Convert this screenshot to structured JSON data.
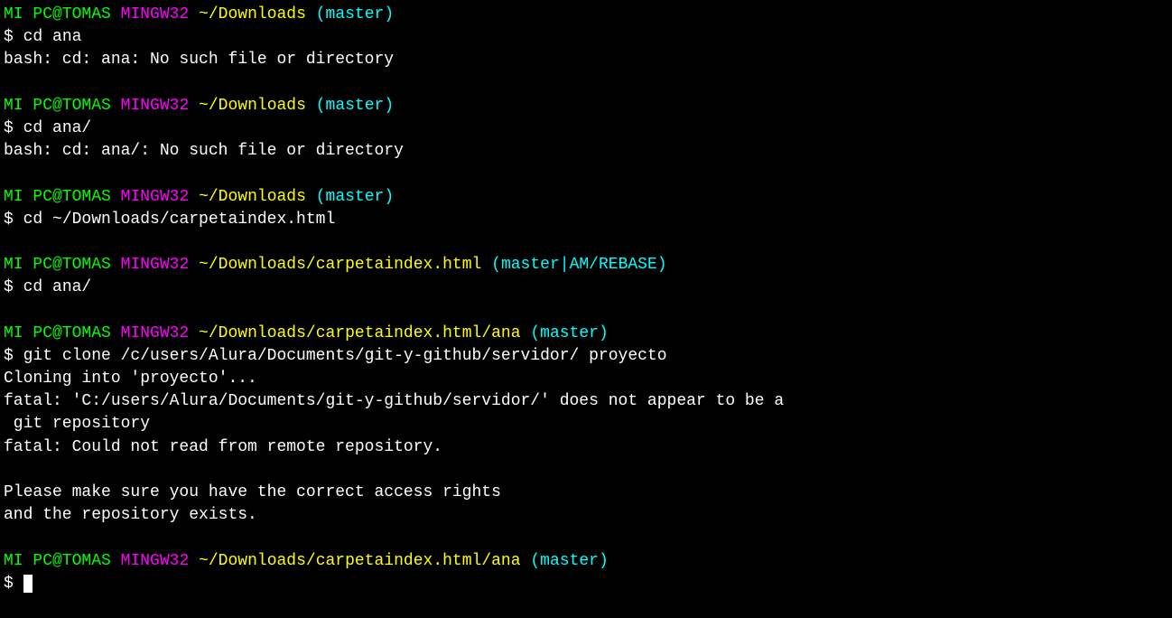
{
  "colors": {
    "user_host": "#00ff00",
    "system": "#ff00ff",
    "path": "#ffff00",
    "branch": "#00ffff",
    "text": "#ffffff"
  },
  "prompt_char": "$",
  "blocks": [
    {
      "user_host": "MI PC@TOMAS",
      "system": "MINGW32",
      "path": "~/Downloads",
      "branch": "(master)",
      "command": "cd ana",
      "output": [
        "bash: cd: ana: No such file or directory"
      ]
    },
    {
      "user_host": "MI PC@TOMAS",
      "system": "MINGW32",
      "path": "~/Downloads",
      "branch": "(master)",
      "command": "cd ana/",
      "output": [
        "bash: cd: ana/: No such file or directory"
      ]
    },
    {
      "user_host": "MI PC@TOMAS",
      "system": "MINGW32",
      "path": "~/Downloads",
      "branch": "(master)",
      "command": "cd ~/Downloads/carpetaindex.html",
      "output": []
    },
    {
      "user_host": "MI PC@TOMAS",
      "system": "MINGW32",
      "path": "~/Downloads/carpetaindex.html",
      "branch": "(master|AM/REBASE)",
      "command": "cd ana/",
      "output": []
    },
    {
      "user_host": "MI PC@TOMAS",
      "system": "MINGW32",
      "path": "~/Downloads/carpetaindex.html/ana",
      "branch": "(master)",
      "command": "git clone /c/users/Alura/Documents/git-y-github/servidor/ proyecto",
      "output": [
        "Cloning into 'proyecto'...",
        "fatal: 'C:/users/Alura/Documents/git-y-github/servidor/' does not appear to be a",
        " git repository",
        "fatal: Could not read from remote repository.",
        "",
        "Please make sure you have the correct access rights",
        "and the repository exists."
      ]
    },
    {
      "user_host": "MI PC@TOMAS",
      "system": "MINGW32",
      "path": "~/Downloads/carpetaindex.html/ana",
      "branch": "(master)",
      "command": "",
      "output": [],
      "cursor": true
    }
  ]
}
